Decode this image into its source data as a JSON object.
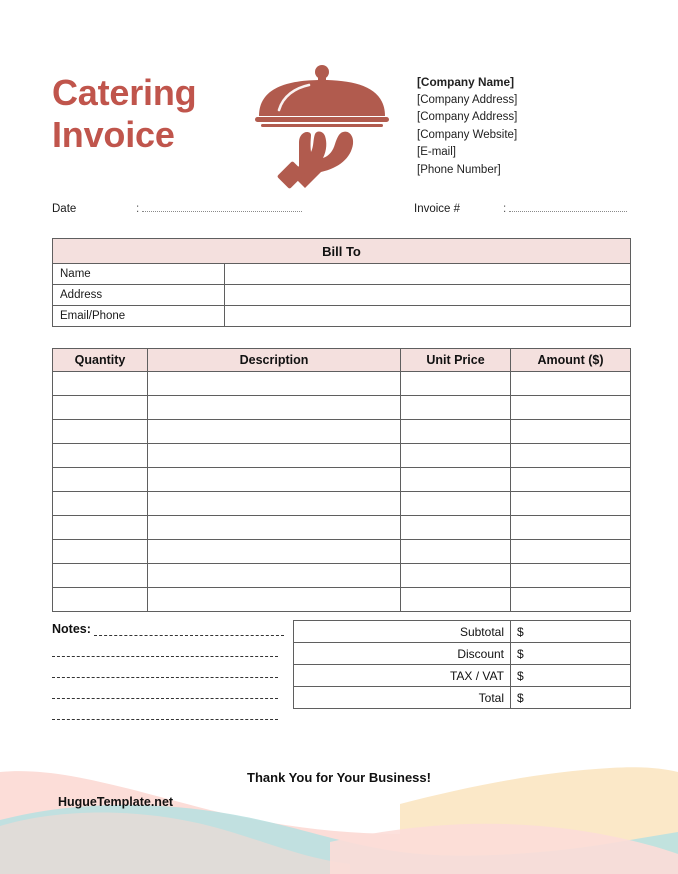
{
  "document": {
    "title_lines": [
      "Catering",
      "Invoice"
    ],
    "accent_color": "#C0554C",
    "logo_color": "#B15B4E",
    "header_fill": "#F4E0DE",
    "logo_icon": "serving-cloche-on-hand-icon"
  },
  "company": {
    "name": "[Company Name]",
    "address_line_1": "[Company Address]",
    "address_line_2": "[Company Address]",
    "website": "[Company Website]",
    "email": "[E-mail]",
    "phone": "[Phone Number]"
  },
  "meta": {
    "date_label": "Date",
    "date_value": "",
    "date_separator": ":",
    "invoice_label": "Invoice #",
    "invoice_value": "",
    "invoice_separator": ":"
  },
  "bill_to": {
    "section_title": "Bill To",
    "rows": [
      {
        "label": "Name",
        "value": ""
      },
      {
        "label": "Address",
        "value": ""
      },
      {
        "label": "Email/Phone",
        "value": ""
      }
    ]
  },
  "items": {
    "columns": [
      "Quantity",
      "Description",
      "Unit Price",
      "Amount ($)"
    ],
    "rows": [
      {
        "quantity": "",
        "description": "",
        "unit_price": "",
        "amount": ""
      },
      {
        "quantity": "",
        "description": "",
        "unit_price": "",
        "amount": ""
      },
      {
        "quantity": "",
        "description": "",
        "unit_price": "",
        "amount": ""
      },
      {
        "quantity": "",
        "description": "",
        "unit_price": "",
        "amount": ""
      },
      {
        "quantity": "",
        "description": "",
        "unit_price": "",
        "amount": ""
      },
      {
        "quantity": "",
        "description": "",
        "unit_price": "",
        "amount": ""
      },
      {
        "quantity": "",
        "description": "",
        "unit_price": "",
        "amount": ""
      },
      {
        "quantity": "",
        "description": "",
        "unit_price": "",
        "amount": ""
      },
      {
        "quantity": "",
        "description": "",
        "unit_price": "",
        "amount": ""
      },
      {
        "quantity": "",
        "description": "",
        "unit_price": "",
        "amount": ""
      }
    ]
  },
  "notes": {
    "label": "Notes:",
    "blank_line_count": 4,
    "value": ""
  },
  "totals": {
    "rows": [
      {
        "label": "Subtotal",
        "currency": "$",
        "value": ""
      },
      {
        "label": "Discount",
        "currency": "$",
        "value": ""
      },
      {
        "label": "TAX / VAT",
        "currency": "$",
        "value": ""
      },
      {
        "label": "Total",
        "currency": "$",
        "value": ""
      }
    ]
  },
  "footer": {
    "thanks": "Thank You for Your Business!",
    "credit": "HugueTemplate.net",
    "wave_colors": {
      "pink": "#FCDDD8",
      "teal": "#B8E0E0",
      "beige": "#FBE8C8",
      "greige": "#E5DAD6"
    }
  }
}
